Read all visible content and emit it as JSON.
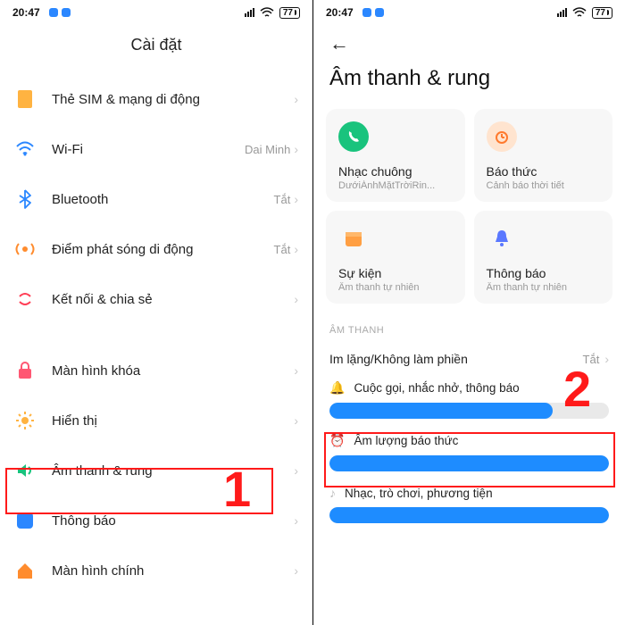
{
  "status": {
    "time": "20:47",
    "battery": "77"
  },
  "pane1": {
    "title": "Cài đặt",
    "rows": [
      {
        "key": "sim",
        "label": "Thẻ SIM & mạng di động",
        "trail": ""
      },
      {
        "key": "wifi",
        "label": "Wi-Fi",
        "trail": "Dai Minh"
      },
      {
        "key": "bluetooth",
        "label": "Bluetooth",
        "trail": "Tắt"
      },
      {
        "key": "hotspot",
        "label": "Điểm phát sóng di động",
        "trail": "Tắt"
      },
      {
        "key": "share",
        "label": "Kết nối & chia sẻ",
        "trail": ""
      },
      {
        "key": "lock",
        "label": "Màn hình khóa",
        "trail": ""
      },
      {
        "key": "display",
        "label": "Hiển thị",
        "trail": ""
      },
      {
        "key": "sound",
        "label": "Âm thanh & rung",
        "trail": ""
      },
      {
        "key": "notif",
        "label": "Thông báo",
        "trail": ""
      },
      {
        "key": "home",
        "label": "Màn hình chính",
        "trail": ""
      }
    ],
    "marker": "1"
  },
  "pane2": {
    "title": "Âm thanh & rung",
    "cards": [
      {
        "key": "ringtone",
        "title": "Nhạc chuông",
        "sub": "DướiÁnhMặtTrờiRin..."
      },
      {
        "key": "alarm",
        "title": "Báo thức",
        "sub": "Cảnh báo thời tiết"
      },
      {
        "key": "event",
        "title": "Sự kiện",
        "sub": "Âm thanh tự nhiên"
      },
      {
        "key": "noti",
        "title": "Thông báo",
        "sub": "Âm thanh tự nhiên"
      }
    ],
    "section": "ÂM THANH",
    "dnd": {
      "label": "Im lặng/Không làm phiền",
      "trail": "Tắt"
    },
    "sliders": [
      {
        "key": "call",
        "label": "Cuộc gọi, nhắc nhở, thông báo",
        "value": 80
      },
      {
        "key": "alarm",
        "label": "Âm lượng báo thức",
        "value": 100
      },
      {
        "key": "media",
        "label": "Nhạc, trò chơi, phương tiện",
        "value": 100
      }
    ],
    "marker": "2"
  }
}
